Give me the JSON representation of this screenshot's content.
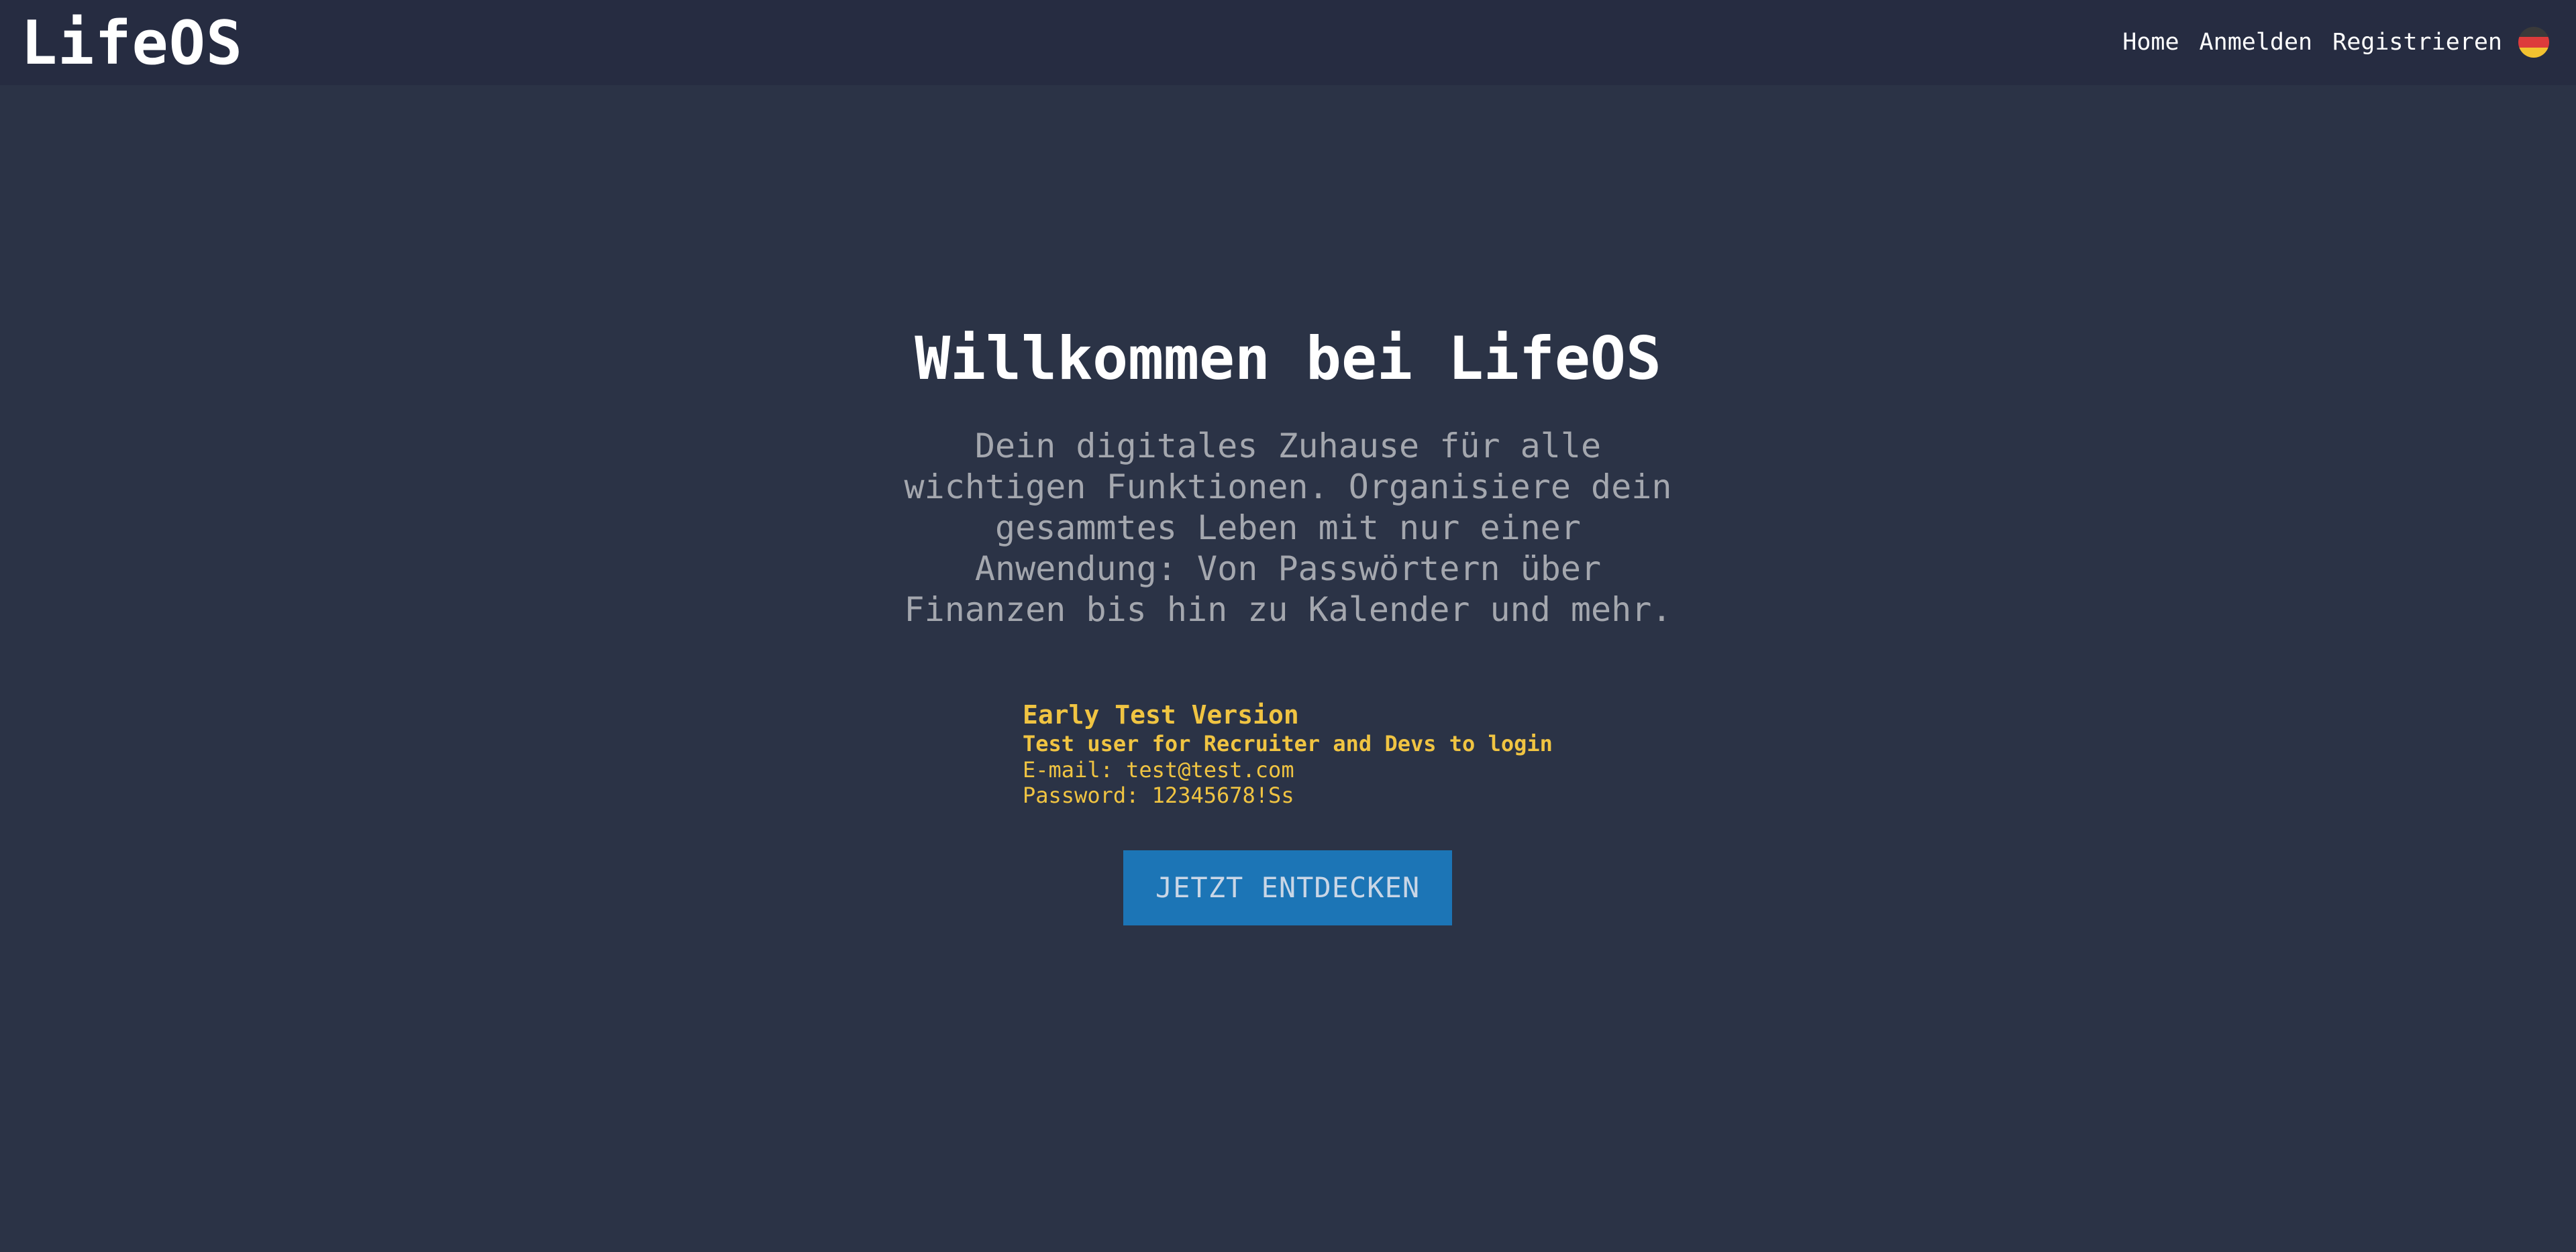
{
  "header": {
    "logo": "LifeOS",
    "nav": [
      {
        "label": "Home"
      },
      {
        "label": "Anmelden"
      },
      {
        "label": "Registrieren"
      }
    ],
    "language_flag": "germany-flag-icon"
  },
  "hero": {
    "title": "Willkommen bei LifeOS",
    "description": "Dein digitales Zuhause für alle wichtigen Funktionen. Organisiere dein gesammtes Leben mit nur einer Anwendung: Von Passwörtern über Finanzen bis hin zu Kalender und mehr."
  },
  "test_info": {
    "title": "Early Test Version",
    "subtitle": "Test user for Recruiter and Devs to login",
    "email_line": "E-mail: test@test.com",
    "password_line": "Password: 12345678!Ss"
  },
  "cta": {
    "label": "JETZT ENTDECKEN"
  },
  "colors": {
    "background": "#2b3346",
    "navbar": "#262c41",
    "accent_yellow": "#f0c442",
    "button_blue": "#1c75b6"
  }
}
